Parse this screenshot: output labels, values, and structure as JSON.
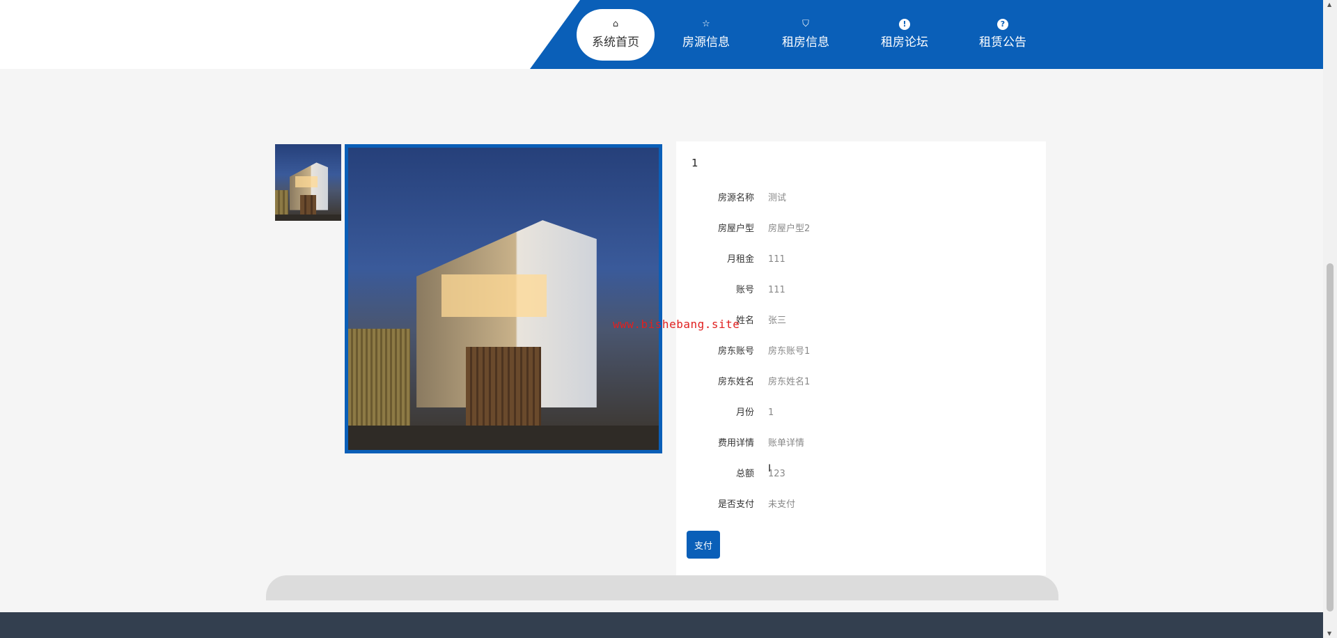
{
  "nav": {
    "items": [
      {
        "label": "系统首页",
        "icon": "home-icon",
        "glyph": "⌂"
      },
      {
        "label": "房源信息",
        "icon": "star-icon",
        "glyph": "☆"
      },
      {
        "label": "租房信息",
        "icon": "bag-icon",
        "glyph": "⛉"
      },
      {
        "label": "租房论坛",
        "icon": "exclamation-circle-icon",
        "glyph": "!"
      },
      {
        "label": "租赁公告",
        "icon": "question-circle-icon",
        "glyph": "?"
      }
    ]
  },
  "detail": {
    "title": "1",
    "fields": [
      {
        "label": "房源名称",
        "value": "测试"
      },
      {
        "label": "房屋户型",
        "value": "房屋户型2"
      },
      {
        "label": "月租金",
        "value": "111"
      },
      {
        "label": "账号",
        "value": "111"
      },
      {
        "label": "姓名",
        "value": "张三"
      },
      {
        "label": "房东账号",
        "value": "房东账号1"
      },
      {
        "label": "房东姓名",
        "value": "房东姓名1"
      },
      {
        "label": "月份",
        "value": "1"
      },
      {
        "label": "费用详情",
        "value": "账单详情"
      },
      {
        "label": "总额",
        "value": "123"
      },
      {
        "label": "是否支付",
        "value": "未支付"
      }
    ],
    "pay_label": "支付"
  },
  "watermark": "www.bishebang.site",
  "colors": {
    "primary": "#0a5fb8",
    "footer": "#333f4f"
  }
}
